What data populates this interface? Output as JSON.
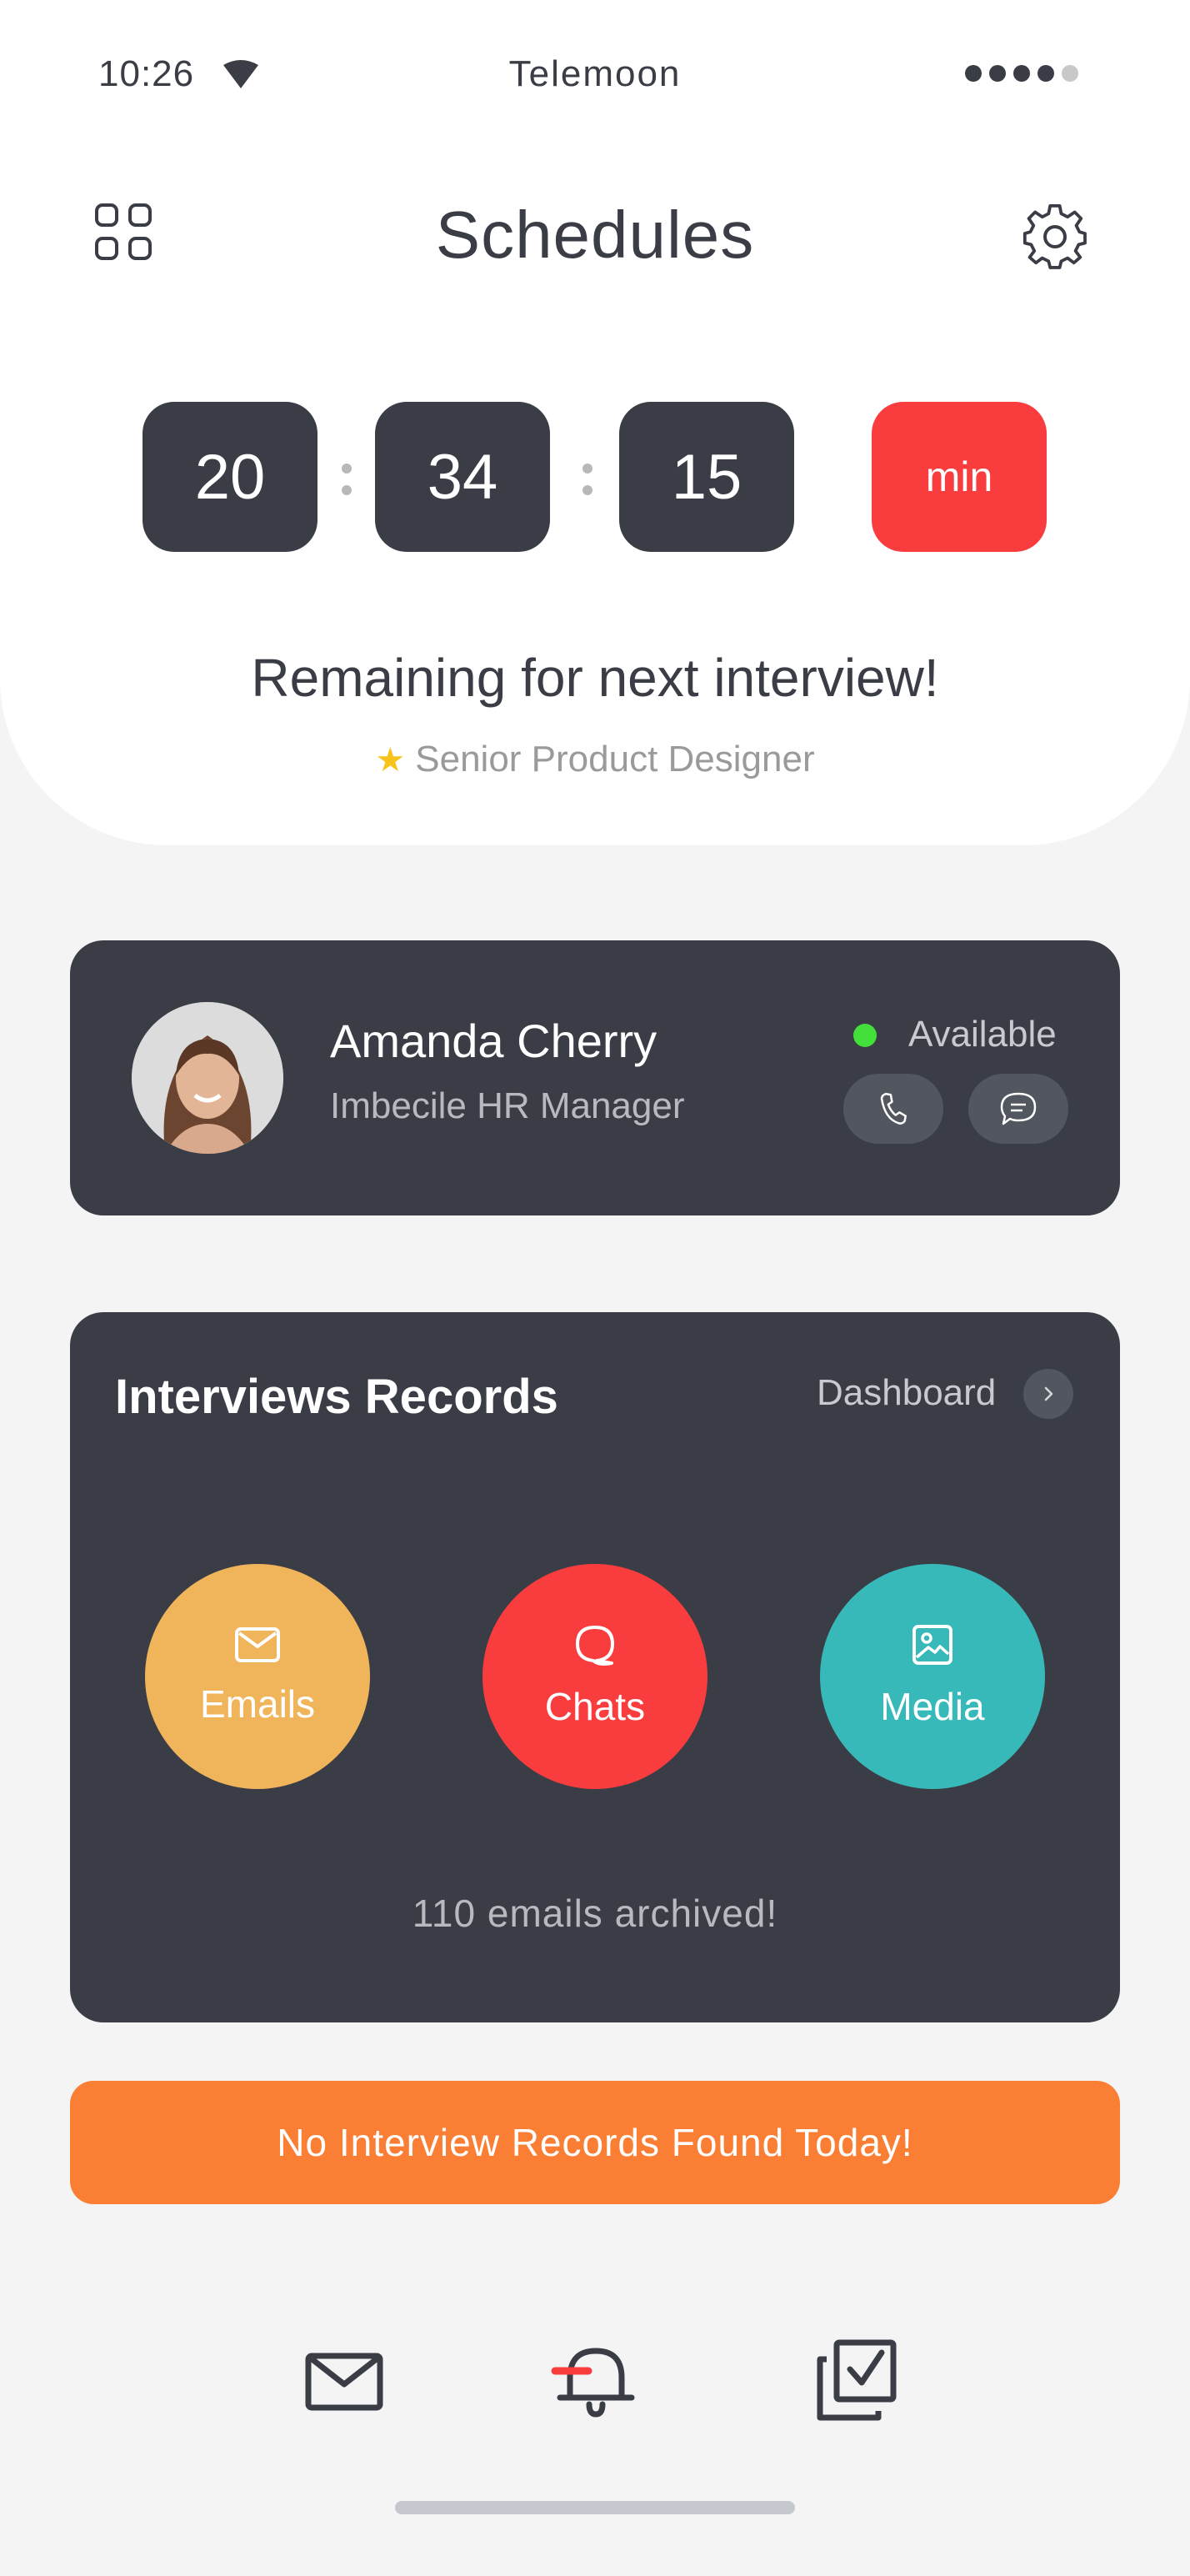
{
  "status_bar": {
    "time": "10:26",
    "carrier": "Telemoon"
  },
  "header": {
    "title": "Schedules"
  },
  "timer": {
    "hours": "20",
    "minutes": "34",
    "seconds": "15",
    "unit": "min"
  },
  "banner": {
    "headline": "Remaining for next interview!",
    "role": "Senior Product Designer"
  },
  "contact": {
    "name": "Amanda Cherry",
    "title": "Imbecile HR Manager",
    "status": "Available"
  },
  "records": {
    "title": "Interviews Records",
    "link": "Dashboard",
    "categories": [
      {
        "label": "Emails"
      },
      {
        "label": "Chats"
      },
      {
        "label": "Media"
      }
    ],
    "summary": "110 emails archived!"
  },
  "notice": "No Interview Records Found Today!",
  "colors": {
    "dark": "#3a3d45",
    "red": "#f93d3e",
    "yellow": "#f0b45b",
    "teal": "#38b9b9",
    "orange": "#fb7e35",
    "green": "#43df3a"
  }
}
